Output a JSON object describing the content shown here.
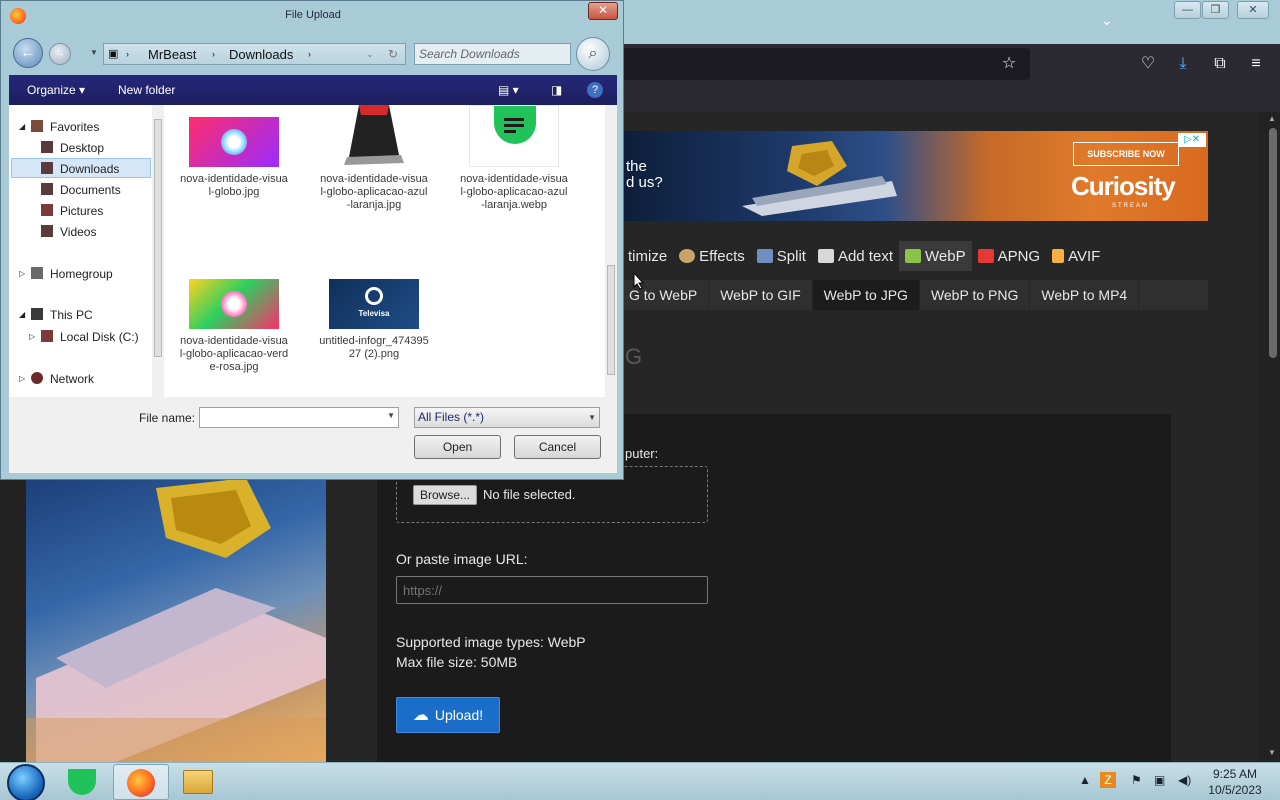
{
  "dialog": {
    "title": "File Upload",
    "address": {
      "segments": [
        "MrBeast",
        "Downloads"
      ]
    },
    "search_placeholder": "Search Downloads",
    "commands": {
      "organize": "Organize",
      "new_folder": "New folder"
    },
    "nav": {
      "favorites": "Favorites",
      "desktop": "Desktop",
      "downloads": "Downloads",
      "documents": "Documents",
      "pictures": "Pictures",
      "videos": "Videos",
      "homegroup": "Homegroup",
      "this_pc": "This PC",
      "local_disk": "Local Disk (C:)",
      "network": "Network"
    },
    "files": [
      {
        "name": "nova-identidade-visual-globo.jpg"
      },
      {
        "name": "nova-identidade-visual-globo-aplicacao-azul-laranja.jpg"
      },
      {
        "name": "nova-identidade-visual-globo-aplicacao-azul-laranja.webp"
      },
      {
        "name": "nova-identidade-visual-globo-aplicacao-verde-rosa.jpg"
      },
      {
        "name": "untitled-infogr_47439527 (2).png",
        "thumb_text": "Televisa"
      }
    ],
    "file_name_label": "File name:",
    "file_name_value": "",
    "filter": "All Files (*.*)",
    "open_label": "Open",
    "cancel_label": "Cancel"
  },
  "page": {
    "ad": {
      "text_line1": "the",
      "text_line2": "d us?",
      "cta": "SUBSCRIBE NOW",
      "brand": "Curiosity",
      "brand_sub": "STREAM"
    },
    "tools": [
      {
        "label": "timize",
        "icon_color": ""
      },
      {
        "label": "Effects",
        "icon_color": "#c9a46a"
      },
      {
        "label": "Split",
        "icon_color": "#6f8fc0"
      },
      {
        "label": "Add text",
        "icon_color": "#d8d8d8"
      },
      {
        "label": "WebP",
        "icon_color": "#8bc34a"
      },
      {
        "label": "APNG",
        "icon_color": "#e53935"
      },
      {
        "label": "AVIF",
        "icon_color": "#f5b041"
      }
    ],
    "subtabs": [
      "G to WebP",
      "WebP to GIF",
      "WebP to JPG",
      "WebP to PNG",
      "WebP to MP4"
    ],
    "active_subtab": "WebP to JPG",
    "heading_fragment": "G",
    "upload_label_fragment": "puter:",
    "browse_label": "Browse...",
    "no_file": "No file selected.",
    "url_label": "Or paste image URL:",
    "url_placeholder": "https://",
    "supported_types": "Supported image types: WebP",
    "max_size": "Max file size: 50MB",
    "upload_button": "Upload!"
  },
  "taskbar": {
    "time": "9:25 AM",
    "date": "10/5/2023"
  },
  "colors": {
    "accent_blue": "#1a6dc8",
    "dialog_command_bar": "#25277a",
    "window_frame": "#a9cbd8"
  }
}
